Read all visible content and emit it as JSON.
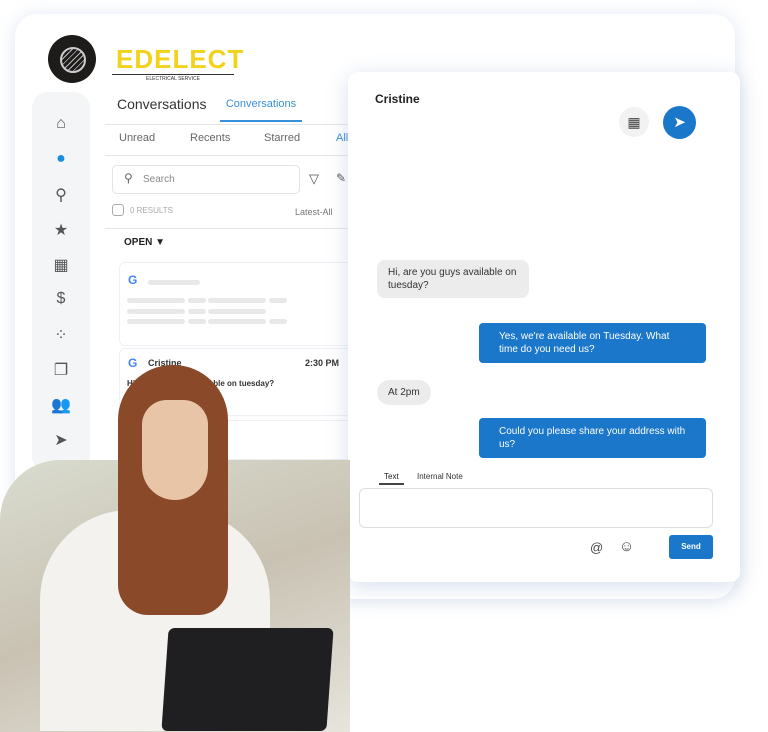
{
  "brand": {
    "name": "EDELECT",
    "tagline": "ELECTRICAL SERVICE"
  },
  "sidebar": {
    "icons": [
      "home-icon",
      "chat-icon",
      "location-icon",
      "star-icon",
      "grid-icon",
      "dollar-icon",
      "network-icon",
      "copy-icon",
      "users-icon",
      "send-icon"
    ]
  },
  "conversations": {
    "title": "Conversations",
    "tab": "Conversations",
    "filters": [
      "Unread",
      "Recents",
      "Starred",
      "All"
    ],
    "search_placeholder": "Search",
    "results": "0 RESULTS",
    "sort": "Latest-All",
    "section": "OPEN",
    "items": [
      {
        "name": "Cristine",
        "time": "2:30 PM",
        "preview": "Hi, are you guys available on tuesday?"
      }
    ]
  },
  "chat": {
    "contact": "Cristine",
    "messages": [
      {
        "dir": "in",
        "text": "Hi, are you guys available on tuesday?"
      },
      {
        "dir": "out",
        "text": "Yes, we're available on Tuesday. What time do you need us?"
      },
      {
        "dir": "in",
        "text": "At 2pm"
      },
      {
        "dir": "out",
        "text": "Could you please share your address with us?"
      }
    ],
    "compose_tabs": [
      "Text",
      "Internal Note"
    ],
    "send": "Send"
  },
  "colors": {
    "accent": "#1a77c9",
    "brand": "#f2d21b"
  }
}
